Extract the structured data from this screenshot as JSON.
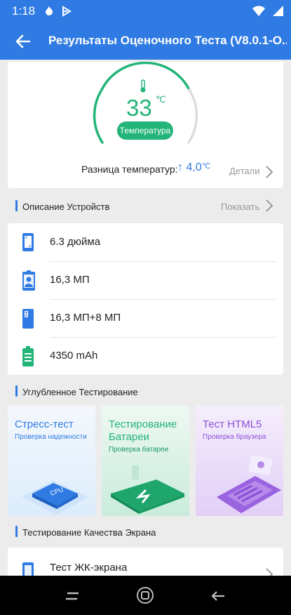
{
  "status": {
    "time": "1:18"
  },
  "appbar": {
    "title": "Результаты Оценочного Теста (V8.0.1-O..."
  },
  "temperature": {
    "value": "33",
    "unit": "℃",
    "badge": "Температура",
    "diff_label": "Разница температур:",
    "diff_value": "↑ 4,0",
    "diff_unit": "℃",
    "details_label": "Детали",
    "accent": "#22b478"
  },
  "device_section": {
    "title": "Описание Устройств",
    "action": "Показать"
  },
  "device_items": [
    {
      "icon": "phone-screen-icon",
      "label": "6.3 дюйма"
    },
    {
      "icon": "front-camera-icon",
      "label": "16,3 МП"
    },
    {
      "icon": "rear-camera-icon",
      "label": "16,3 МП+8 МП"
    },
    {
      "icon": "battery-icon",
      "label": "4350 mAh"
    }
  ],
  "advanced_section": {
    "title": "Углубленное Тестирование"
  },
  "tiles": [
    {
      "title": "Стресс-тест",
      "subtitle": "Проверка надежности",
      "color": "#2f7be3"
    },
    {
      "title": "Тестирование Батареи",
      "subtitle": "Проверка батареи",
      "color": "#22b478"
    },
    {
      "title": "Тест HTML5",
      "subtitle": "Проверка браузера",
      "color": "#8b4fd8"
    }
  ],
  "screen_section": {
    "title": "Тестирование Качества Экрана"
  },
  "screen_items": [
    {
      "label": "Тест ЖК-экрана"
    }
  ],
  "colors": {
    "primary": "#2f7be3",
    "green": "#22b478",
    "purple": "#8b4fd8"
  }
}
